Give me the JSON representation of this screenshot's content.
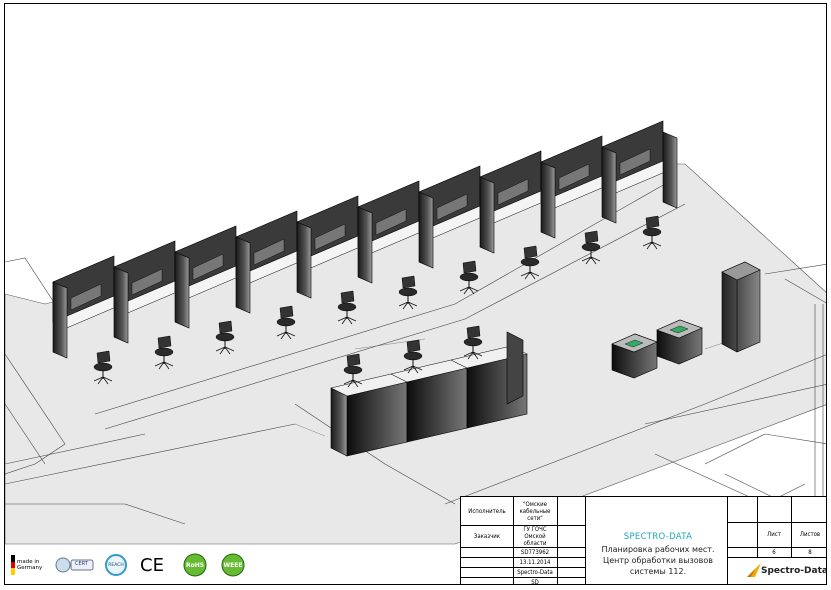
{
  "title_block": {
    "contractor_label": "Исполнитель",
    "contractor_value": "\"Омские кабельные сети\"",
    "customer_label": "Заказчик",
    "customer_value": "ГУ ГОЧС Омской области",
    "code": "SD773962",
    "date": "13.11.2014",
    "author_org": "Spectro-Data",
    "initials": "SD",
    "brand": "SPECTRO-DATA",
    "description": "Планировка рабочих мест. Центр обработки вызовов системы 112.",
    "sheet_label": "Лист",
    "sheets_label": "Листов",
    "sheet_no": "6",
    "sheets_total": "8",
    "company_logo_text": "Spectro-Data"
  },
  "cert_logos": {
    "made_in": "made in Germany",
    "ce": "CE",
    "rohs": "RoHS",
    "weee": "WEEE",
    "cert": "CERT",
    "reach": "REACH"
  }
}
